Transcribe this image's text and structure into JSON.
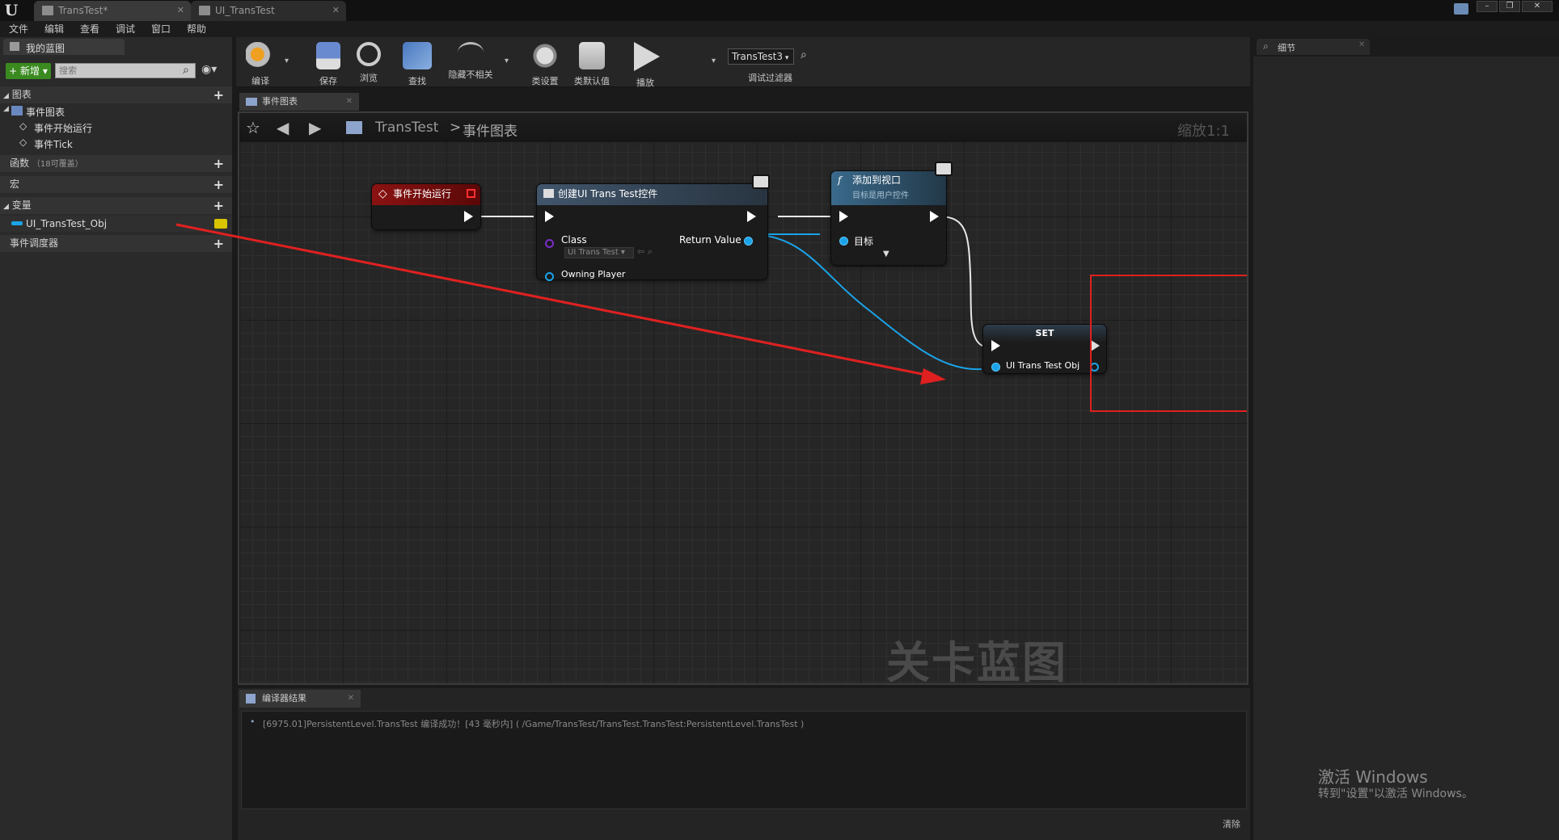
{
  "app": {
    "logo": "U",
    "tabs": [
      {
        "label": "TransTest*"
      },
      {
        "label": "UI_TransTest"
      }
    ],
    "window_buttons": [
      "–",
      "❐",
      "✕"
    ]
  },
  "menu": [
    "文件",
    "编辑",
    "查看",
    "调试",
    "窗口",
    "帮助"
  ],
  "my_blueprint": {
    "title": "我的蓝图",
    "add_button": "+ 新增 ▾",
    "search_placeholder": "搜索",
    "sections": {
      "graphs": "图表",
      "event_graph": "事件图表",
      "events": [
        "事件开始运行",
        "事件Tick"
      ],
      "functions": "函数",
      "functions_override": "（18可覆盖）",
      "macros": "宏",
      "variables": "变量",
      "variable_items": [
        {
          "name": "UI_TransTest_Obj"
        }
      ],
      "dispatchers": "事件调度器"
    }
  },
  "toolbar": {
    "compile": "编译",
    "save": "保存",
    "browse": "浏览",
    "find": "查找",
    "hide_unrelated": "隐藏不相关",
    "class_settings": "类设置",
    "class_defaults": "类默认值",
    "play": "播放",
    "debug_object": "TransTest3",
    "debug_filter": "调试过滤器"
  },
  "graph": {
    "tab_label": "事件图表",
    "breadcrumb_root": "TransTest",
    "breadcrumb_sep": ">",
    "breadcrumb_current": "事件图表",
    "zoom": "缩放1:1",
    "watermark": "关卡蓝图",
    "nodes": {
      "begin_play": {
        "title": "事件开始运行",
        "color": "#7a1010"
      },
      "create_widget": {
        "title": "创建UI Trans Test控件",
        "class_pin": "Class",
        "class_value": "UI Trans Test",
        "owning_player_pin": "Owning Player",
        "return_pin": "Return Value"
      },
      "add_to_viewport": {
        "title": "添加到视口",
        "subtitle": "目标是用户控件",
        "target_pin": "目标"
      },
      "set": {
        "title": "SET",
        "var_pin": "UI Trans Test Obj"
      }
    }
  },
  "details": {
    "title": "细节"
  },
  "compiler": {
    "tab_label": "编译器结果",
    "message": "[6975.01]PersistentLevel.TransTest 编译成功！[43 毫秒内] ( /Game/TransTest/TransTest.TransTest:PersistentLevel.TransTest )",
    "clear": "清除"
  },
  "activation": {
    "title": "激活 Windows",
    "subtitle": "转到\"设置\"以激活 Windows。"
  },
  "colors": {
    "exec": "#ffffff",
    "object_pin": "#1ba3e8",
    "highlight": "#e02020",
    "class_pin": "#7a2ec8"
  }
}
